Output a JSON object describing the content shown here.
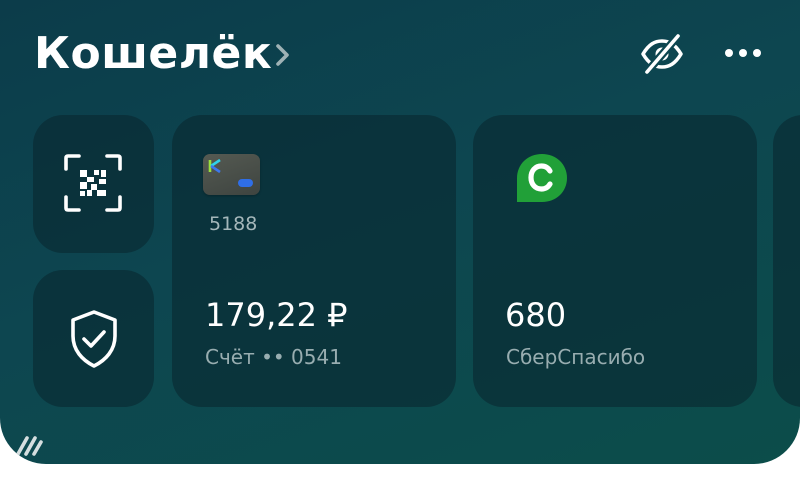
{
  "header": {
    "title": "Кошелёк",
    "chevron_icon": "chevron-right-icon",
    "hide_balance_icon": "eye-off-icon",
    "more_icon": "more-dots-icon"
  },
  "quick_actions": [
    {
      "icon": "qr-scan-icon"
    },
    {
      "icon": "shield-check-icon"
    }
  ],
  "card": {
    "number": "5188",
    "balance": "179,22 ₽",
    "account": "Счёт •• 0541"
  },
  "spasibo": {
    "value": "680",
    "label": "СберСпасибо",
    "logo_color": "#21a038"
  },
  "colors": {
    "background": "#0d4650",
    "tile": "#0a2830",
    "text": "#ffffff",
    "muted": "#98adb0"
  }
}
